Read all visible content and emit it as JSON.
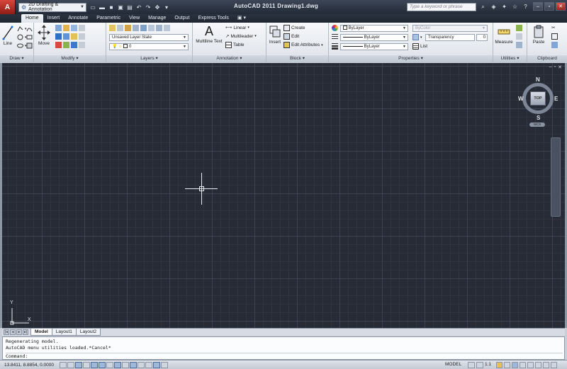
{
  "titlebar": {
    "workspace": "2D Drafting & Annotation",
    "title": "AutoCAD 2011   Drawing1.dwg",
    "search_placeholder": "Type a keyword or phrase"
  },
  "ribbon_tabs": [
    "Home",
    "Insert",
    "Annotate",
    "Parametric",
    "View",
    "Manage",
    "Output",
    "Express Tools"
  ],
  "active_tab": "Home",
  "panels": {
    "draw": {
      "title": "Draw",
      "line_label": "Line"
    },
    "modify": {
      "title": "Modify",
      "move_label": "Move"
    },
    "layers": {
      "title": "Layers",
      "layer_state": "Unsaved Layer State",
      "current_layer": "0"
    },
    "annotation": {
      "title": "Annotation",
      "multiline_text": "Multiline Text",
      "linear": "Linear",
      "multileader": "Multileader",
      "table": "Table"
    },
    "block": {
      "title": "Block",
      "insert": "Insert",
      "create": "Create",
      "edit": "Edit",
      "edit_attributes": "Edit Attributes"
    },
    "properties": {
      "title": "Properties",
      "color": "ByLayer",
      "linetype": "ByLayer",
      "lineweight": "ByLayer",
      "plot_style": "ByColor",
      "transparency_label": "Transparency",
      "transparency_value": "0",
      "list": "List"
    },
    "utilities": {
      "title": "Utilities",
      "measure": "Measure"
    },
    "clipboard": {
      "title": "Clipboard",
      "paste": "Paste"
    }
  },
  "viewcube": {
    "top_label": "TOP",
    "north": "N",
    "south": "S",
    "east": "E",
    "west": "W",
    "wcs": "WCS"
  },
  "ucs": {
    "x": "X",
    "y": "Y"
  },
  "layout_tabs": [
    "Model",
    "Layout1",
    "Layout2"
  ],
  "active_layout": "Model",
  "command_history": [
    "Regenerating model.",
    "AutoCAD menu utilities loaded.*Cancel*"
  ],
  "command_prompt": "Command:",
  "status": {
    "coordinates": "13.8411, 8.8854, 0.0000",
    "space": "MODEL",
    "annotation_scale": "1:1"
  },
  "colors": {
    "canvas": "#262b35",
    "titlebar": "#2b3340",
    "ribbon": "#e8ecf1"
  }
}
